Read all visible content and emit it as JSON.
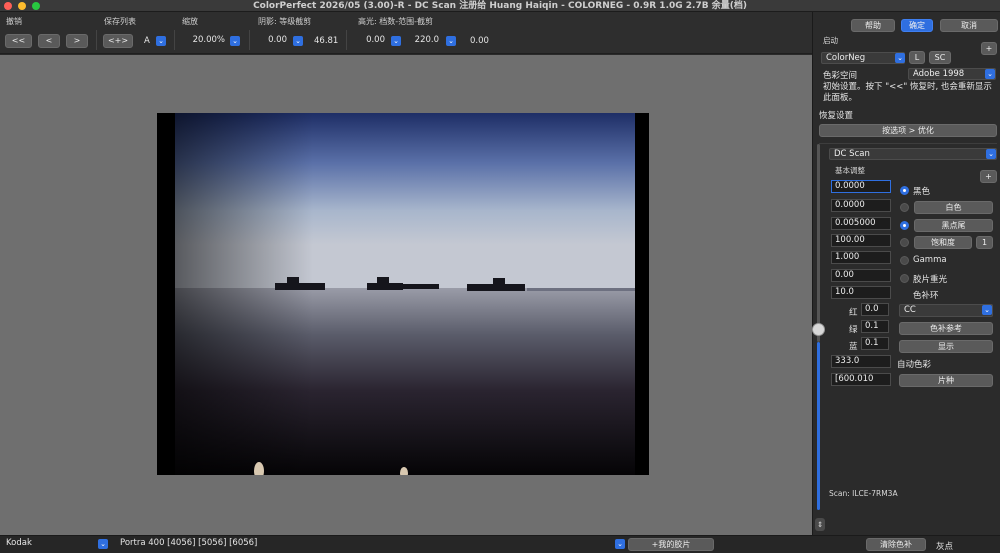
{
  "window": {
    "title": "ColorPerfect 2026/05 (3.00)-R -  DC Scan 注册给 Huang Haiqin - COLORNEG - 0.9R 1.0G 2.7B 余量(档)"
  },
  "toolbar": {
    "undo_label": "撤销",
    "undo_btn": "<<",
    "prev_btn": "<",
    "next_btn": ">",
    "savelist_label": "保存列表",
    "swap_btn": "<+>",
    "slot_value": "A",
    "zoom_label": "缩放",
    "zoom_value": "20.00%",
    "shadow_label": "阴影: 等级截剪",
    "shadow_value": "0.00",
    "shadow_right": "46.81",
    "highlight_label": "高光: 档数-范围-截剪",
    "hl_value1": "0.00",
    "hl_value2": "220.0",
    "hl_value3": "0.00"
  },
  "panel": {
    "help_btn": "帮助",
    "ok_btn": "确定",
    "cancel_btn": "取消",
    "startup_label": "启动",
    "plus": "+",
    "mode_select": "ColorNeg",
    "l_btn": "L",
    "sc_btn": "SC",
    "colorspace_label": "色彩空间",
    "colorspace_value": "Adobe 1998",
    "info_text": "初始设置。按下 \"<<\" 恢复时, 也会重新显示此面板。",
    "restore_label": "恢复设置",
    "optimize_btn": "按选项 > 优化",
    "scan_select": "DC Scan",
    "basic_label": "基本调整",
    "black_value": "0.0000",
    "black_label": "黑色",
    "white_value": "0.0000",
    "white_btn": "白色",
    "blacktail_value": "0.005000",
    "blacktail_btn": "黑点尾",
    "saturation_value": "100.00",
    "saturation_btn": "饱和度",
    "saturation_num": "1",
    "gamma_value": "1.000",
    "gamma_label": "Gamma",
    "filmexp_value": "0.00",
    "filmexp_label": "胶片重光",
    "cc_value": "10.0",
    "cc_label": "色补环",
    "red_label": "红",
    "red_value": "0.0",
    "cc_select": "CC",
    "green_label": "绿",
    "green_value": "0.1",
    "ccref_btn": "色补参考",
    "blue_label": "蓝",
    "blue_value": "0.1",
    "show_btn": "显示",
    "auto_value": "333.0",
    "auto_label": "自动色彩",
    "filmtype_value": "[600.010",
    "filmtype_btn": "片种",
    "scan_info": "Scan: ILCE-7RM3A"
  },
  "bottom": {
    "brand_select": "Kodak",
    "film_select": "Portra 400 [4056] [5056] [6056]",
    "myfilm_btn": "+我的胶片",
    "clear_btn": "清除色补",
    "gray_label": "灰点"
  },
  "colors": {
    "accent": "#2f6fe0",
    "traffic_red": "#ff5f57",
    "traffic_yellow": "#febc2e",
    "traffic_green": "#28c840"
  }
}
